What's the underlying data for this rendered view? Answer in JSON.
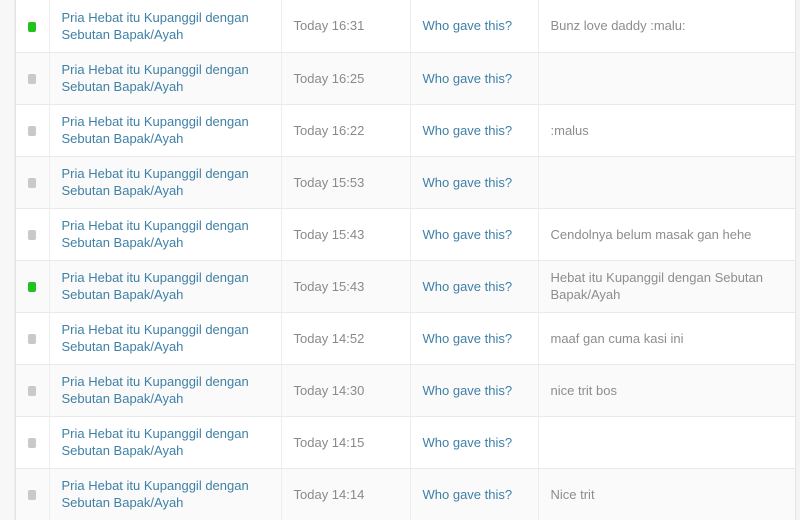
{
  "colors": {
    "link": "#3f80a6",
    "status_new": "#22c11e",
    "status_read": "#c9c9c9",
    "muted_text": "#8a8a8a",
    "row_alt": "#fafafa",
    "row_base": "#ffffff",
    "border": "#e9e9e9",
    "page_bg": "#f4f4f4"
  },
  "table": {
    "columns": [
      {
        "key": "status",
        "label": ""
      },
      {
        "key": "title",
        "label": ""
      },
      {
        "key": "time",
        "label": ""
      },
      {
        "key": "who",
        "label": ""
      },
      {
        "key": "message",
        "label": ""
      }
    ],
    "rows": [
      {
        "status": "new",
        "status_icon": "unread-dot-icon",
        "title": "Pria Hebat itu Kupanggil dengan Sebutan Bapak/Ayah",
        "time": "Today 16:31",
        "who": "Who gave this?",
        "message": "Bunz love daddy :malu:"
      },
      {
        "status": "read",
        "status_icon": "read-dot-icon",
        "title": "Pria Hebat itu Kupanggil dengan Sebutan Bapak/Ayah",
        "time": "Today 16:25",
        "who": "Who gave this?",
        "message": ""
      },
      {
        "status": "read",
        "status_icon": "read-dot-icon",
        "title": "Pria Hebat itu Kupanggil dengan Sebutan Bapak/Ayah",
        "time": "Today 16:22",
        "who": "Who gave this?",
        "message": ":malus"
      },
      {
        "status": "read",
        "status_icon": "read-dot-icon",
        "title": "Pria Hebat itu Kupanggil dengan Sebutan Bapak/Ayah",
        "time": "Today 15:53",
        "who": "Who gave this?",
        "message": ""
      },
      {
        "status": "read",
        "status_icon": "read-dot-icon",
        "title": "Pria Hebat itu Kupanggil dengan Sebutan Bapak/Ayah",
        "time": "Today 15:43",
        "who": "Who gave this?",
        "message": "Cendolnya belum masak gan hehe"
      },
      {
        "status": "new",
        "status_icon": "unread-dot-icon",
        "title": "Pria Hebat itu Kupanggil dengan Sebutan Bapak/Ayah",
        "time": "Today 15:43",
        "who": "Who gave this?",
        "message": "Hebat itu Kupanggil dengan Sebutan Bapak/Ayah"
      },
      {
        "status": "read",
        "status_icon": "read-dot-icon",
        "title": "Pria Hebat itu Kupanggil dengan Sebutan Bapak/Ayah",
        "time": "Today 14:52",
        "who": "Who gave this?",
        "message": "maaf gan cuma kasi ini"
      },
      {
        "status": "read",
        "status_icon": "read-dot-icon",
        "title": "Pria Hebat itu Kupanggil dengan Sebutan Bapak/Ayah",
        "time": "Today 14:30",
        "who": "Who gave this?",
        "message": "nice trit bos"
      },
      {
        "status": "read",
        "status_icon": "read-dot-icon",
        "title": "Pria Hebat itu Kupanggil dengan Sebutan Bapak/Ayah",
        "time": "Today 14:15",
        "who": "Who gave this?",
        "message": ""
      },
      {
        "status": "read",
        "status_icon": "read-dot-icon",
        "title": "Pria Hebat itu Kupanggil dengan Sebutan Bapak/Ayah",
        "time": "Today 14:14",
        "who": "Who gave this?",
        "message": "Nice trit"
      }
    ]
  }
}
